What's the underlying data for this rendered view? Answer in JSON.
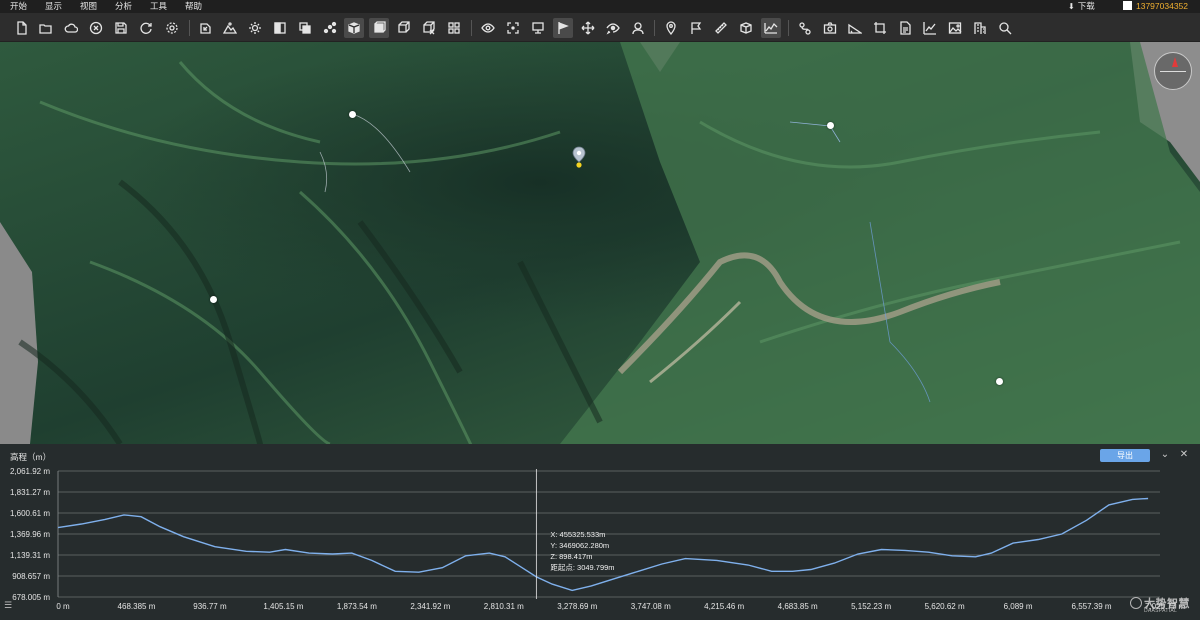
{
  "menu": {
    "items": [
      "开始",
      "显示",
      "视图",
      "分析",
      "工具",
      "帮助"
    ],
    "download_label": "下载",
    "user_phone": "13797034352"
  },
  "toolbar": {
    "tools": [
      "new-file-icon",
      "open-folder-icon",
      "cloud-icon",
      "close-circle-icon",
      "save-icon",
      "refresh-icon",
      "settings-icon",
      "import-icon",
      "terrain-icon",
      "light-icon",
      "split-view-icon",
      "layer-copy-icon",
      "points-icon",
      "cube-solid-icon",
      "box-icon",
      "cube-wire-icon",
      "cube-cross-icon",
      "grid-icon",
      "eye-icon",
      "extent-icon",
      "monitor-icon",
      "flag-icon",
      "pan-move-icon",
      "view-rotate-icon",
      "face-icon",
      "location-pin-icon",
      "flag-line-icon",
      "ruler-icon",
      "volume-box-icon",
      "profile-chart-icon",
      "route-icon",
      "camera-icon",
      "slope-icon",
      "crop-icon",
      "report-icon",
      "trend-icon",
      "image-icon",
      "building-icon",
      "search-icon"
    ],
    "active_tools": [
      "cube-solid-icon",
      "box-icon",
      "flag-icon",
      "profile-chart-icon"
    ]
  },
  "panel": {
    "title": "高程（m）",
    "export_label": "导出",
    "logo_text": "大势智慧",
    "logo_sub": "DAASPATIAL"
  },
  "chart_data": {
    "type": "line",
    "title": "高程（m）",
    "ylim": [
      678.005,
      2061.92
    ],
    "xlim": [
      0,
      7000
    ],
    "y_ticks": [
      "2,061.92 m",
      "1,831.27 m",
      "1,600.61 m",
      "1,369.96 m",
      "1,139.31 m",
      "908.657 m",
      "678.005 m"
    ],
    "y_tick_values": [
      2061.92,
      1831.27,
      1600.61,
      1369.96,
      1139.31,
      908.657,
      678.005
    ],
    "x_ticks": [
      "0 m",
      "468.385 m",
      "936.77 m",
      "1,405.15 m",
      "1,873.54 m",
      "2,341.92 m",
      "2,810.31 m",
      "3,278.69 m",
      "3,747.08 m",
      "4,215.46 m",
      "4,683.85 m",
      "5,152.23 m",
      "5,620.62 m",
      "6,089 m",
      "6,557.39 m",
      "7,025.77 m"
    ],
    "x_tick_values": [
      0,
      468.385,
      936.77,
      1405.15,
      1873.54,
      2341.92,
      2810.31,
      3278.69,
      3747.08,
      4215.46,
      4683.85,
      5152.23,
      5620.62,
      6089,
      6557.39,
      7025.77
    ],
    "series": [
      {
        "color": "#7fb0ec",
        "x": [
          0,
          150,
          300,
          420,
          530,
          650,
          800,
          1000,
          1200,
          1350,
          1450,
          1600,
          1750,
          1873,
          2000,
          2150,
          2300,
          2450,
          2600,
          2750,
          2850,
          2950,
          3049.8,
          3150,
          3278,
          3400,
          3550,
          3700,
          3850,
          4000,
          4200,
          4400,
          4550,
          4683,
          4800,
          4950,
          5100,
          5250,
          5400,
          5550,
          5700,
          5850,
          5950,
          6089,
          6250,
          6400,
          6557,
          6700,
          6850,
          6950
        ],
        "y": [
          1440,
          1480,
          1530,
          1580,
          1560,
          1450,
          1340,
          1230,
          1180,
          1170,
          1200,
          1160,
          1150,
          1160,
          1080,
          960,
          950,
          1000,
          1130,
          1160,
          1120,
          1010,
          898.4,
          820,
          750,
          800,
          880,
          960,
          1040,
          1100,
          1080,
          1030,
          960,
          960,
          980,
          1050,
          1150,
          1200,
          1190,
          1170,
          1130,
          1120,
          1160,
          1270,
          1310,
          1370,
          1520,
          1690,
          1750,
          1760
        ]
      }
    ],
    "crosshair": {
      "x": 3049.799,
      "labels": [
        "X: 455325.533m",
        "Y: 3469062.280m",
        "Z: 898.417m",
        "距起点: 3049.799m"
      ]
    }
  }
}
